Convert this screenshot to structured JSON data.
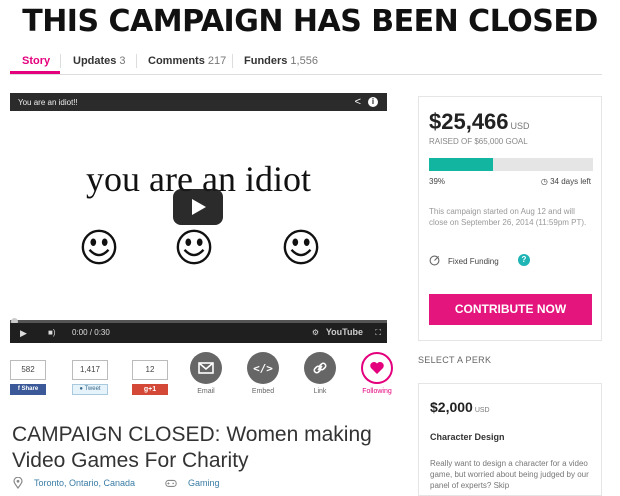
{
  "banner": "THIS CAMPAIGN HAS BEEN CLOSED",
  "tabs": [
    {
      "label": "Story",
      "count": ""
    },
    {
      "label": "Updates",
      "count": "3"
    },
    {
      "label": "Comments",
      "count": "217"
    },
    {
      "label": "Funders",
      "count": "1,556"
    }
  ],
  "video": {
    "title": "You are an idiot!!",
    "headline": "you are an idiot",
    "time": "0:00 / 0:30",
    "brand": "YouTube",
    "progress": 0
  },
  "social": {
    "facebook": {
      "count": "582",
      "label": "Share"
    },
    "twitter": {
      "count": "1,417",
      "label": "Tweet"
    },
    "gplus": {
      "count": "12",
      "label": "+1"
    },
    "email": "Email",
    "embed": "Embed",
    "link": "Link",
    "following": "Following"
  },
  "campaign": {
    "title": "CAMPAIGN CLOSED: Women making Video Games For Charity",
    "location": "Toronto, Ontario, Canada",
    "category": "Gaming"
  },
  "funding": {
    "amount": "$25,466",
    "currency": "USD",
    "goal": "RAISED OF $65,000 GOAL",
    "percent": "39%",
    "percent_value": 0.39,
    "days_left": "34 days left",
    "note": "This campaign started on Aug 12 and will close on September 26, 2014 (11:59pm PT).",
    "type": "Fixed Funding",
    "cta": "CONTRIBUTE NOW",
    "accent": "#e4157d",
    "progress_color": "#12b5a0"
  },
  "perks": {
    "heading": "SELECT A PERK",
    "items": [
      {
        "amount": "$2,000",
        "currency": "USD",
        "title": "Character Design",
        "description": "Really want to design a character for a video game, but worried about being judged by our panel of experts? Skip"
      }
    ]
  }
}
